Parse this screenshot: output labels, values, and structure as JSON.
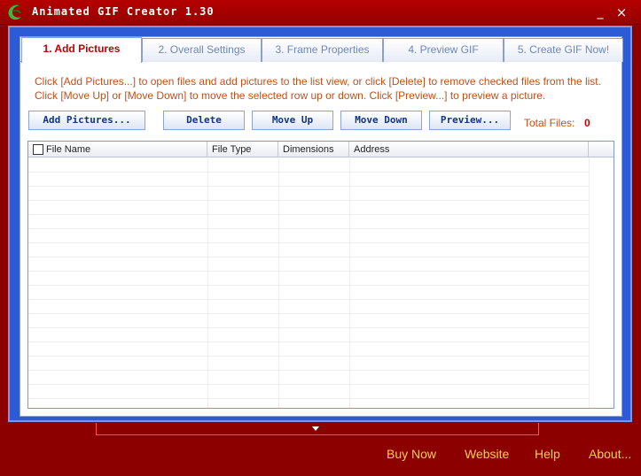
{
  "window": {
    "title": "Animated GIF Creator 1.30",
    "minimize_symbol": "_",
    "close_symbol": "×"
  },
  "tabs": [
    {
      "label": "1. Add Pictures",
      "active": true
    },
    {
      "label": "2. Overall Settings",
      "active": false
    },
    {
      "label": "3. Frame Properties",
      "active": false
    },
    {
      "label": "4. Preview GIF",
      "active": false
    },
    {
      "label": "5. Create GIF Now!",
      "active": false
    }
  ],
  "instructions": {
    "line1": "Click [Add Pictures...] to open files and add pictures to the list view, or click [Delete] to remove checked files from the list.",
    "line2": "Click [Move Up] or [Move Down] to move the selected row up or down. Click [Preview...] to preview a picture."
  },
  "toolbar": {
    "add_pictures": "Add Pictures...",
    "delete": "Delete",
    "move_up": "Move Up",
    "move_down": "Move Down",
    "preview": "Preview...",
    "total_files_label": "Total Files:",
    "total_files_value": "0"
  },
  "listview": {
    "columns": [
      "File Name",
      "File Type",
      "Dimensions",
      "Address"
    ],
    "rows": []
  },
  "footer": {
    "buy_now": "Buy Now",
    "website": "Website",
    "help": "Help",
    "about": "About..."
  },
  "colors": {
    "background": "#8c0000",
    "frame": "#2d5bd6",
    "active_tab": "#c00000",
    "instruction_text": "#c0501a",
    "footer_link": "#ffcc55"
  }
}
